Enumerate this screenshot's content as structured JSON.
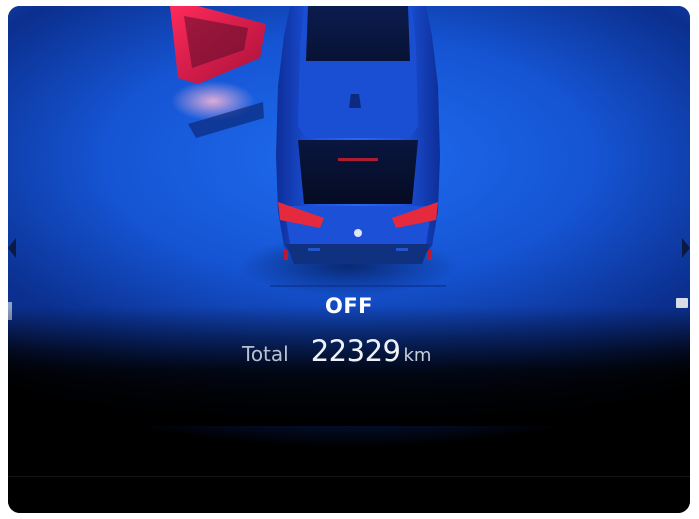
{
  "display": {
    "status": "OFF",
    "odometer": {
      "label": "Total",
      "value": "22329",
      "unit": "km"
    }
  },
  "car": {
    "body_color": "#1b4fd6",
    "door_color": "#e0234f",
    "open_door": "front-left",
    "icons": [
      "car-top-view-icon",
      "bmw-logo-icon",
      "door-open-icon"
    ]
  },
  "colors": {
    "background_blue": "#1554d3",
    "text": "#ffffff"
  }
}
